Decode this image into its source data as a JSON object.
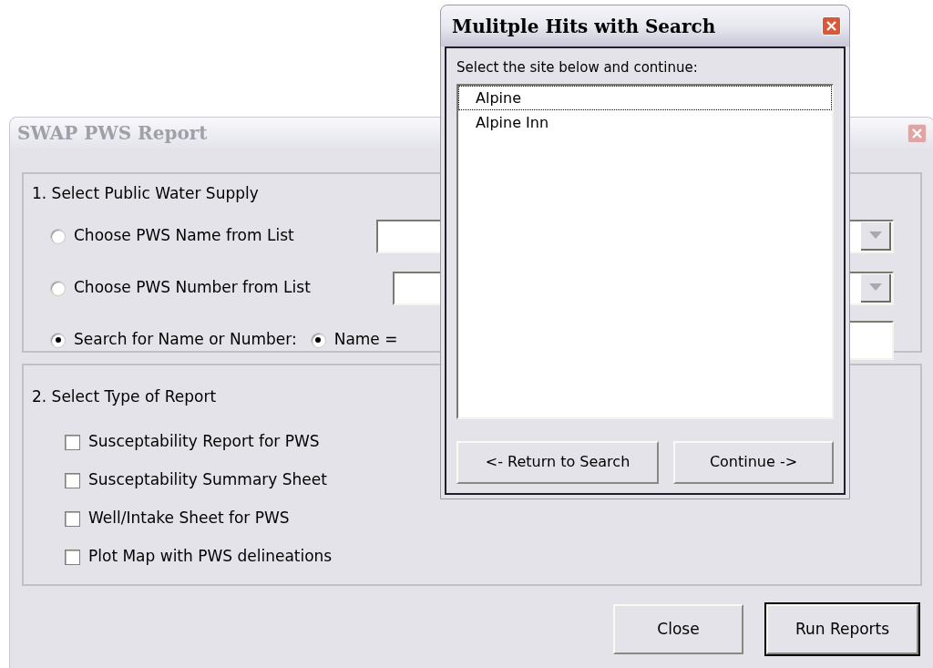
{
  "main_window": {
    "title": "SWAP PWS Report",
    "active": false,
    "section_1": {
      "heading": "1. Select Public Water Supply",
      "options": [
        {
          "label": "Choose PWS Name from List",
          "selected": false,
          "kind": "dropdown"
        },
        {
          "label": "Choose PWS Number from List",
          "selected": false,
          "kind": "dropdown"
        },
        {
          "label": "Search for Name or Number:",
          "selected": true,
          "kind": "search",
          "sub_option": {
            "label": "Name =",
            "selected": true
          }
        }
      ]
    },
    "section_2": {
      "heading": "2. Select Type of Report",
      "reports": [
        {
          "label": "Susceptability Report for PWS",
          "checked": false
        },
        {
          "label": "Susceptability Summary Sheet",
          "checked": false
        },
        {
          "label": "Well/Intake Sheet for PWS",
          "checked": false
        },
        {
          "label": "Plot Map with PWS delineations",
          "checked": false
        }
      ]
    },
    "buttons": [
      {
        "label": "Close",
        "default": false
      },
      {
        "label": "Run Reports",
        "default": true
      }
    ]
  },
  "dialog": {
    "title": "Mulitple Hits with Search",
    "prompt": "Select the site below and continue:",
    "sites": [
      {
        "label": "Alpine",
        "focused": true
      },
      {
        "label": "Alpine Inn",
        "focused": false
      }
    ],
    "buttons": [
      "<- Return to Search",
      "Continue ->"
    ]
  }
}
